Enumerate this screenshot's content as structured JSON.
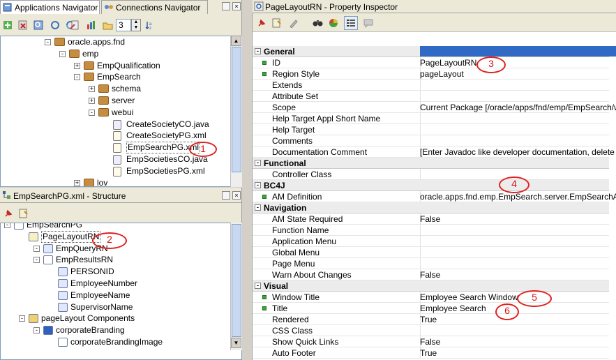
{
  "left_tabs": {
    "apps_navigator": "Applications Navigator",
    "connections_navigator": "Connections Navigator"
  },
  "nav_toolbar": {
    "depth_value": "3"
  },
  "nav_tree": [
    {
      "label": "oracle.apps.fnd",
      "kind": "pkg",
      "depth": 0,
      "exp": "-"
    },
    {
      "label": "emp",
      "kind": "pkg",
      "depth": 1,
      "exp": "-"
    },
    {
      "label": "EmpQualification",
      "kind": "pkg",
      "depth": 2,
      "exp": "+"
    },
    {
      "label": "EmpSearch",
      "kind": "pkg",
      "depth": 2,
      "exp": "-"
    },
    {
      "label": "schema",
      "kind": "pkg",
      "depth": 3,
      "exp": "+"
    },
    {
      "label": "server",
      "kind": "pkg",
      "depth": 3,
      "exp": "+"
    },
    {
      "label": "webui",
      "kind": "pkg",
      "depth": 3,
      "exp": "-"
    },
    {
      "label": "CreateSocietyCO.java",
      "kind": "java",
      "depth": 4,
      "exp": ""
    },
    {
      "label": "CreateSocietyPG.xml",
      "kind": "xml",
      "depth": 4,
      "exp": ""
    },
    {
      "label": "EmpSearchPG.xml",
      "kind": "xml",
      "depth": 4,
      "exp": "",
      "selected": true
    },
    {
      "label": "EmpSocietiesCO.java",
      "kind": "java",
      "depth": 4,
      "exp": ""
    },
    {
      "label": "EmpSocietiesPG.xml",
      "kind": "xml",
      "depth": 4,
      "exp": ""
    },
    {
      "label": "lov",
      "kind": "pkg",
      "depth": 2,
      "exp": "+"
    }
  ],
  "structure": {
    "title": "EmpSearchPG.xml - Structure",
    "tree": [
      {
        "label": "EmpSearchPG",
        "depth": 0,
        "kind": "page"
      },
      {
        "label": "PageLayoutRN",
        "depth": 1,
        "kind": "region",
        "selected": true
      },
      {
        "label": "EmpQueryRN",
        "depth": 2,
        "kind": "query"
      },
      {
        "label": "EmpResultsRN",
        "depth": 2,
        "kind": "table"
      },
      {
        "label": "PERSONID",
        "depth": 3,
        "kind": "item"
      },
      {
        "label": "EmployeeNumber",
        "depth": 3,
        "kind": "item"
      },
      {
        "label": "EmployeeName",
        "depth": 3,
        "kind": "item"
      },
      {
        "label": "SupervisorName",
        "depth": 3,
        "kind": "item"
      },
      {
        "label": "pageLayout Components",
        "depth": 1,
        "kind": "folder"
      },
      {
        "label": "corporateBranding",
        "depth": 2,
        "kind": "branding"
      },
      {
        "label": "corporateBrandingImage",
        "depth": 3,
        "kind": "image"
      }
    ]
  },
  "inspector": {
    "title": "PageLayoutRN - Property Inspector",
    "rows": [
      {
        "cat": true,
        "k": "General"
      },
      {
        "k": "ID",
        "v": "PageLayoutRN",
        "dot": true
      },
      {
        "k": "Region Style",
        "v": "pageLayout",
        "dot": true
      },
      {
        "k": "Extends",
        "v": ""
      },
      {
        "k": "Attribute Set",
        "v": ""
      },
      {
        "k": "Scope",
        "v": "Current Package [/oracle/apps/fnd/emp/EmpSearch/webui]"
      },
      {
        "k": "Help Target Appl Short Name",
        "v": ""
      },
      {
        "k": "Help Target",
        "v": ""
      },
      {
        "k": "Comments",
        "v": ""
      },
      {
        "k": "Documentation Comment",
        "v": "[Enter Javadoc like developer documentation, delete this"
      },
      {
        "cat": true,
        "k": "Functional"
      },
      {
        "k": "Controller Class",
        "v": ""
      },
      {
        "cat": true,
        "k": "BC4J"
      },
      {
        "k": "AM Definition",
        "v": "oracle.apps.fnd.emp.EmpSearch.server.EmpSearchAM",
        "dot": true
      },
      {
        "cat": true,
        "k": "Navigation"
      },
      {
        "k": "AM State Required",
        "v": "False"
      },
      {
        "k": "Function Name",
        "v": ""
      },
      {
        "k": "Application Menu",
        "v": ""
      },
      {
        "k": "Global Menu",
        "v": ""
      },
      {
        "k": "Page Menu",
        "v": ""
      },
      {
        "k": "Warn About Changes",
        "v": "False"
      },
      {
        "cat": true,
        "k": "Visual"
      },
      {
        "k": "Window Title",
        "v": "Employee Search Window",
        "dot": true
      },
      {
        "k": "Title",
        "v": "Employee Search",
        "dot": true
      },
      {
        "k": "Rendered",
        "v": "True"
      },
      {
        "k": "CSS Class",
        "v": ""
      },
      {
        "k": "Show Quick Links",
        "v": "False"
      },
      {
        "k": "Auto Footer",
        "v": "True"
      }
    ]
  },
  "annotations": [
    "1",
    "2",
    "3",
    "4",
    "5",
    "6"
  ],
  "colors": {
    "selection": "#316ac5",
    "accent_red": "#e02020",
    "package": "#c68c40"
  }
}
